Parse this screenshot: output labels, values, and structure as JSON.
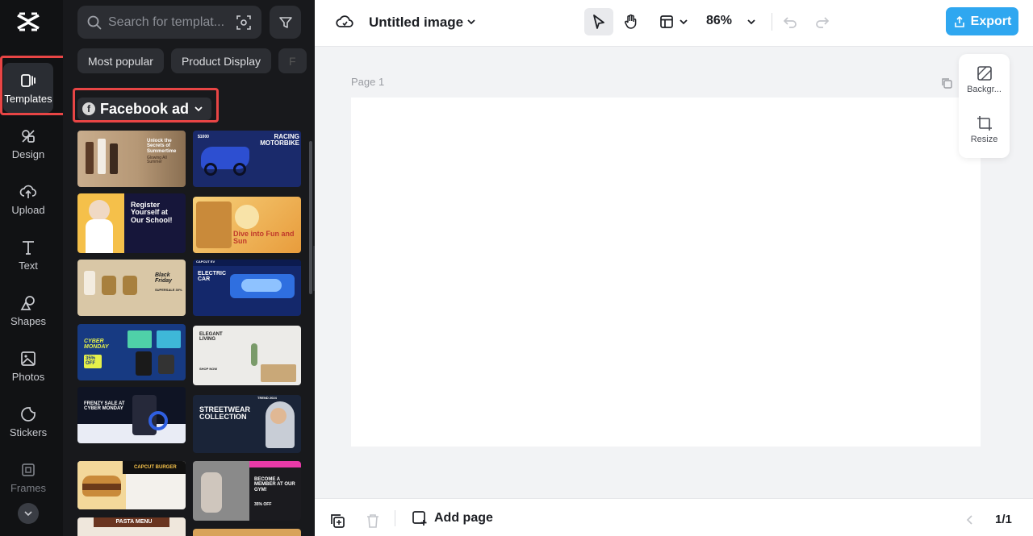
{
  "rail": {
    "items": [
      {
        "label": "Templates",
        "icon": "templates-icon"
      },
      {
        "label": "Design",
        "icon": "design-icon"
      },
      {
        "label": "Upload",
        "icon": "upload-icon"
      },
      {
        "label": "Text",
        "icon": "text-icon"
      },
      {
        "label": "Shapes",
        "icon": "shapes-icon"
      },
      {
        "label": "Photos",
        "icon": "photos-icon"
      },
      {
        "label": "Stickers",
        "icon": "stickers-icon"
      },
      {
        "label": "Frames",
        "icon": "frames-icon"
      }
    ],
    "highlight_color": "#e84545"
  },
  "panel": {
    "search_placeholder": "Search for templat...",
    "chips": [
      "Most popular",
      "Product Display",
      "F"
    ],
    "category": "Facebook ad",
    "templates": [
      {
        "title": "Unlock the Secrets of Summertime",
        "subtitle": "Glowing All Summer"
      },
      {
        "title": "RACING MOTORBIKE",
        "subtitle": "$1000"
      },
      {
        "title": "Register Yourself at Our School!",
        "subtitle": ""
      },
      {
        "title": "Dive into Fun and Sun",
        "subtitle": ""
      },
      {
        "title": "Black Friday",
        "subtitle": "SUPERSALE 30%"
      },
      {
        "title": "ELECTRIC CAR",
        "subtitle": "CAPCUT EV"
      },
      {
        "title": "CYBER MONDAY",
        "subtitle": "35% OFF"
      },
      {
        "title": "ELEGANT LIVING",
        "subtitle": "SHOP NOW"
      },
      {
        "title": "FRENZY SALE AT CYBER MONDAY",
        "subtitle": ""
      },
      {
        "title": "STREETWEAR COLLECTION",
        "subtitle": "TREND 2024"
      },
      {
        "title": "CAPCUT BURGER",
        "subtitle": ""
      },
      {
        "title": "BECOME A MEMBER AT OUR GYM!",
        "subtitle": "35% OFF"
      },
      {
        "title": "PASTA MENU",
        "subtitle": ""
      },
      {
        "title": "",
        "subtitle": ""
      }
    ]
  },
  "topbar": {
    "title": "Untitled image",
    "zoom": "86%",
    "export_label": "Export",
    "accent": "#2fa7f0"
  },
  "canvas": {
    "page_label": "Page 1",
    "float_panel": {
      "background_label": "Backgr...",
      "resize_label": "Resize"
    }
  },
  "bottombar": {
    "add_page_label": "Add page",
    "pager": "1/1"
  }
}
